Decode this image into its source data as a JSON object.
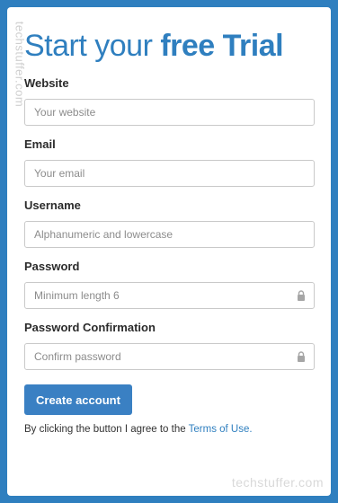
{
  "watermark": "techstuffer.com",
  "form": {
    "title_light": "Start your",
    "title_bold": "free Trial",
    "fields": [
      {
        "label": "Website",
        "placeholder": "Your website"
      },
      {
        "label": "Email",
        "placeholder": "Your email"
      },
      {
        "label": "Username",
        "placeholder": "Alphanumeric and lowercase"
      },
      {
        "label": "Password",
        "placeholder": "Minimum length 6"
      },
      {
        "label": "Password Confirmation",
        "placeholder": "Confirm password"
      }
    ],
    "submit_label": "Create account",
    "terms_prefix": "By clicking the button I agree to the",
    "terms_link": "Terms of Use."
  },
  "colors": {
    "accent": "#2f7fbf",
    "button": "#3a80c3"
  }
}
